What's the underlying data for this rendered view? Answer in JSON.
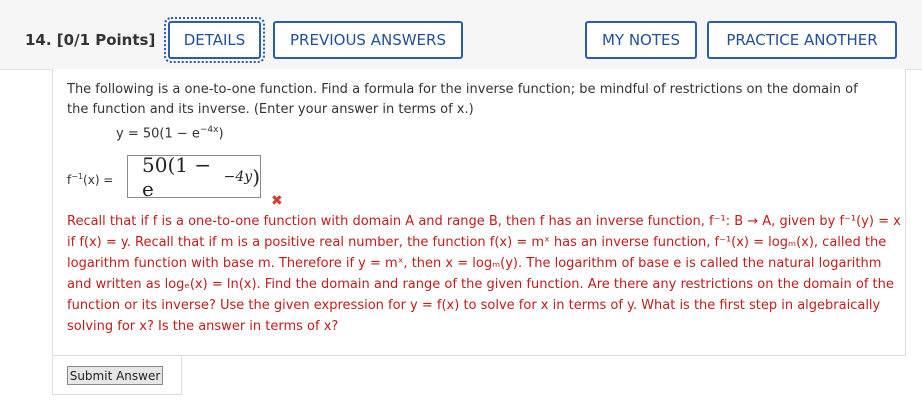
{
  "header": {
    "question": "14. [0/1 Points]",
    "buttons": {
      "details": "DETAILS",
      "previous": "PREVIOUS ANSWERS",
      "notes": "MY NOTES",
      "practice": "PRACTICE ANOTHER"
    }
  },
  "problem": {
    "prompt_line1": "The following is a one-to-one function. Find a formula for the inverse function; be mindful of restrictions on the domain of",
    "prompt_line2": "the function and its inverse. (Enter your answer in terms of x.)",
    "equation": "y = 50(1 − e",
    "equation_exp": "−4x",
    "equation_end": ")"
  },
  "answer": {
    "label": "f",
    "label_exp": "−1",
    "label_rest": "(x) =",
    "value_main": "50(1 − e",
    "value_exp": "−4y",
    "value_end": ")",
    "status": "incorrect-icon"
  },
  "feedback": {
    "text": "Recall that if f is a one-to-one function with domain A and range B, then f has an inverse function, f⁻¹: B → A, given by f⁻¹(y) = x if f(x) = y. Recall that if m is a positive real number, the function f(x) = mˣ has an inverse function, f⁻¹(x) = logₘ(x), called the logarithm function with base m. Therefore if y = mˣ, then x = logₘ(y). The logarithm of base e is called the natural logarithm and written as logₑ(x) = ln(x). Find the domain and range of the given function. Are there any restrictions on the domain of the function or its inverse? Use the given expression for y = f(x) to solve for x in terms of y. What is the first step in algebraically solving for x? Is the answer in terms of x?"
  },
  "submit": {
    "label": "Submit Answer"
  }
}
